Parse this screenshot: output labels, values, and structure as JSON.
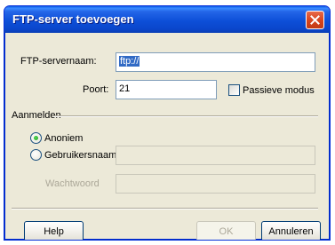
{
  "window": {
    "title": "FTP-server toevoegen"
  },
  "form": {
    "server_label": "FTP-servernaam:",
    "server_value": "ftp://",
    "port_label": "Poort:",
    "port_value": "21",
    "passive_label": "Passieve modus",
    "passive_checked": false
  },
  "login": {
    "group_label": "Aanmelden",
    "anonymous_label": "Anoniem",
    "anonymous_selected": true,
    "username_label": "Gebruikersnaam",
    "password_label": "Wachtwoord",
    "username_value": "",
    "password_value": ""
  },
  "buttons": {
    "help": "Help",
    "ok": "OK",
    "cancel": "Annuleren"
  },
  "colors": {
    "titlebar": "#0A46CC",
    "dialog_bg": "#ECE9D8",
    "close_button": "#D8451F",
    "selection": "#316AC5"
  }
}
